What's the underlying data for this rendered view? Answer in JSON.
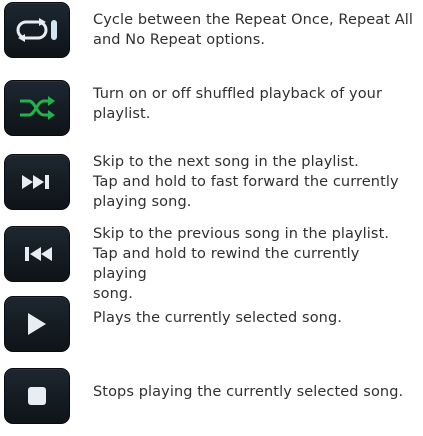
{
  "colors": {
    "button_dark": "#141b22",
    "icon_light": "#e7edf2",
    "repeat_accent": "#cfe6f2",
    "shuffle_active": "#23b14d",
    "text": "#2f3032"
  },
  "controls": [
    {
      "icon": "repeat-icon",
      "description": "Cycle between the Repeat Once, Repeat All\nand No Repeat options."
    },
    {
      "icon": "shuffle-icon",
      "description": "Turn on or off shuffled playback of your\nplaylist."
    },
    {
      "icon": "next-track-icon",
      "description": "Skip to the next song in the playlist.\nTap and hold to fast forward the currently\nplaying song."
    },
    {
      "icon": "previous-track-icon",
      "description": "Skip to the previous song in the playlist.\nTap and hold to rewind the currently playing\nsong."
    },
    {
      "icon": "play-icon",
      "description": "Plays the currently selected song."
    },
    {
      "icon": "stop-icon",
      "description": "Stops playing the currently selected song."
    }
  ]
}
